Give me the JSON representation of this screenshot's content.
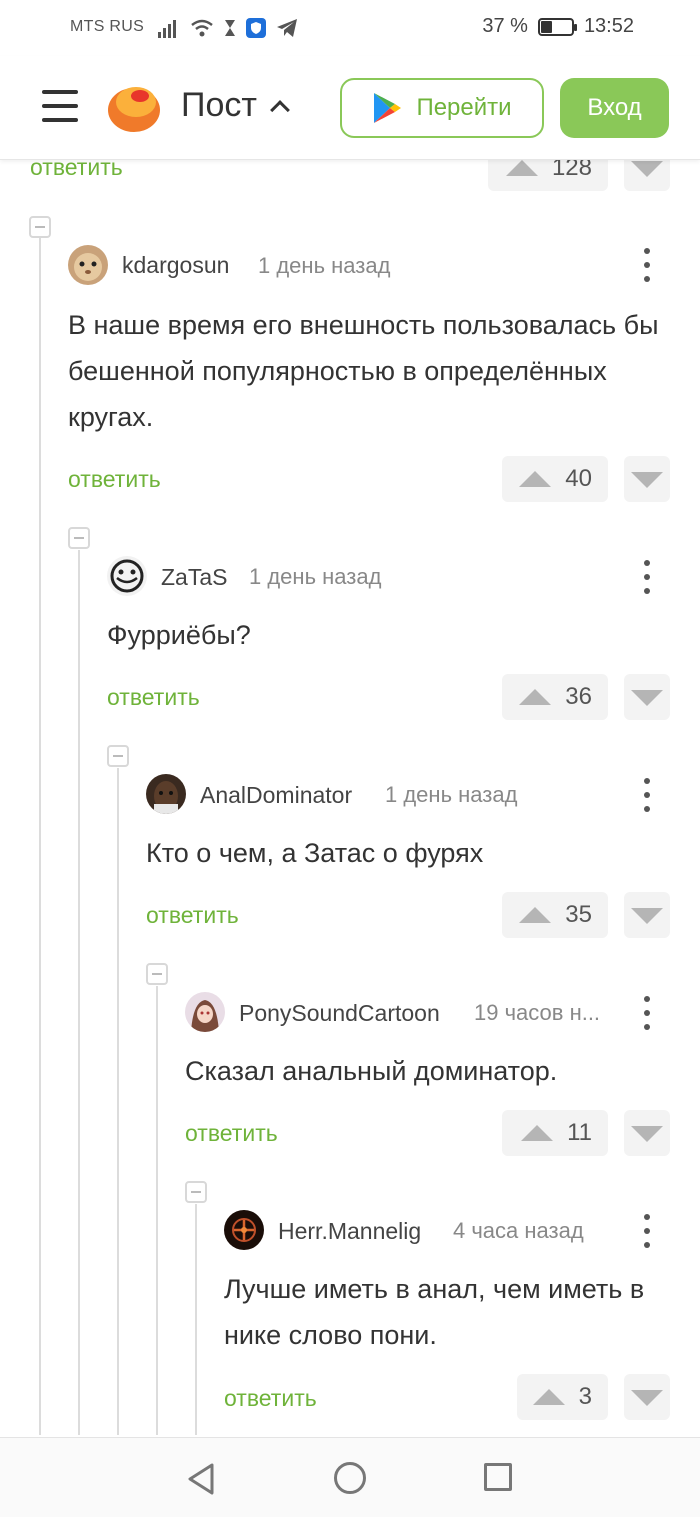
{
  "status_bar": {
    "carrier": "MTS RUS",
    "battery_percent": "37 %",
    "battery_level": 0.37,
    "time": "13:52"
  },
  "header": {
    "title": "Пост",
    "go_label": "Перейти",
    "login_label": "Вход"
  },
  "top_partial": {
    "reply_label": "ответить",
    "score": "128"
  },
  "comments": [
    {
      "author": "kdargosun",
      "time": "1 день назад",
      "text": "В наше время его внешность пользовалась бы бешенной популярностью в определённых кругах.",
      "reply_label": "ответить",
      "score": "40"
    },
    {
      "author": "ZaTaS",
      "time": "1 день назад",
      "text": "Фурриёбы?",
      "reply_label": "ответить",
      "score": "36"
    },
    {
      "author": "AnalDominator",
      "time": "1 день назад",
      "text": "Кто о чем, а Затас о фурях",
      "reply_label": "ответить",
      "score": "35"
    },
    {
      "author": "PonySoundCartoon",
      "time": "19 часов н...",
      "text": "Сказал анальный доминатор.",
      "reply_label": "ответить",
      "score": "11"
    },
    {
      "author": "Herr.Mannelig",
      "time": "4 часа назад",
      "text": "Лучше иметь в анал, чем иметь в нике слово пони.",
      "reply_label": "ответить",
      "score": "3"
    }
  ],
  "colors": {
    "accent_green": "#8ac858",
    "reply_green": "#6fb33a",
    "logo_orange": "#f07a2a"
  },
  "icons": [
    "menu-icon",
    "pikabu-logo-icon",
    "chevron-up-icon",
    "google-play-icon",
    "more-vertical-icon",
    "upvote-icon",
    "downvote-icon",
    "collapse-icon",
    "back-icon",
    "home-icon",
    "recents-icon"
  ]
}
